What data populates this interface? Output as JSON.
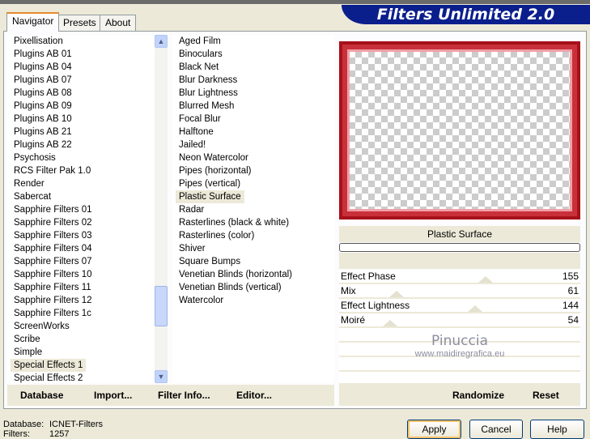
{
  "app_title": "Filters Unlimited 2.0",
  "tabs": [
    "Navigator",
    "Presets",
    "About"
  ],
  "categories": [
    "Pixellisation",
    "Plugins AB 01",
    "Plugins AB 04",
    "Plugins AB 07",
    "Plugins AB 08",
    "Plugins AB 09",
    "Plugins AB 10",
    "Plugins AB 21",
    "Plugins AB 22",
    "Psychosis",
    "RCS Filter Pak 1.0",
    "Render",
    "Sabercat",
    "Sapphire Filters 01",
    "Sapphire Filters 02",
    "Sapphire Filters 03",
    "Sapphire Filters 04",
    "Sapphire Filters 07",
    "Sapphire Filters 10",
    "Sapphire Filters 11",
    "Sapphire Filters 12",
    "Sapphire Filters 1c",
    "ScreenWorks",
    "Scribe",
    "Simple",
    "Special Effects 1",
    "Special Effects 2"
  ],
  "selected_category": "Special Effects 1",
  "filters": [
    "Aged Film",
    "Binoculars",
    "Black Net",
    "Blur Darkness",
    "Blur Lightness",
    "Blurred Mesh",
    "Focal Blur",
    "Halftone",
    "Jailed!",
    "Neon Watercolor",
    "Pipes (horizontal)",
    "Pipes (vertical)",
    "Plastic Surface",
    "Radar",
    "Rasterlines (black & white)",
    "Rasterlines (color)",
    "Shiver",
    "Square Bumps",
    "Venetian Blinds (horizontal)",
    "Venetian Blinds (vertical)",
    "Watercolor"
  ],
  "selected_filter": "Plastic Surface",
  "filter_name": "Plastic Surface",
  "progress": 0,
  "sliders": [
    {
      "label": "Effect Phase",
      "value": 155
    },
    {
      "label": "Mix",
      "value": 61
    },
    {
      "label": "Effect Lightness",
      "value": 144
    },
    {
      "label": "Moiré",
      "value": 54
    }
  ],
  "slider_max": 255,
  "watermark": {
    "name": "Pinuccia",
    "url": "www.maidiregrafica.eu"
  },
  "left_buttons": [
    "Database",
    "Import...",
    "Filter Info...",
    "Editor..."
  ],
  "right_buttons": [
    "Randomize",
    "Reset"
  ],
  "status": {
    "database_label": "Database:",
    "database_value": "ICNET-Filters",
    "filters_label": "Filters:",
    "filters_value": "1257"
  },
  "dialog_buttons": {
    "apply": "Apply",
    "cancel": "Cancel",
    "help": "Help"
  }
}
